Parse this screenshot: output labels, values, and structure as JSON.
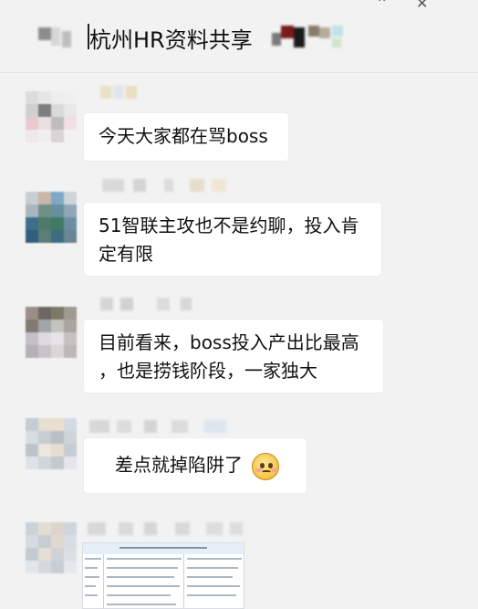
{
  "header": {
    "title": "杭州HR资料共享",
    "controls": [
      "minimize",
      "close"
    ]
  },
  "messages": [
    {
      "text": "今天大家都在骂boss"
    },
    {
      "text_line1": "51智联主攻也不是约聊，投入肯",
      "text_line2": "定有限"
    },
    {
      "text_line1": "目前看来，boss投入产出比最高",
      "text_line2": "，也是捞钱阶段，一家独大"
    },
    {
      "text": "差点就掉陷阱了",
      "emoji": "pleading-face"
    },
    {
      "attachment": "document-image"
    }
  ],
  "colors": {
    "background": "#f2f2f2",
    "bubble": "#ffffff",
    "text": "#111111"
  }
}
